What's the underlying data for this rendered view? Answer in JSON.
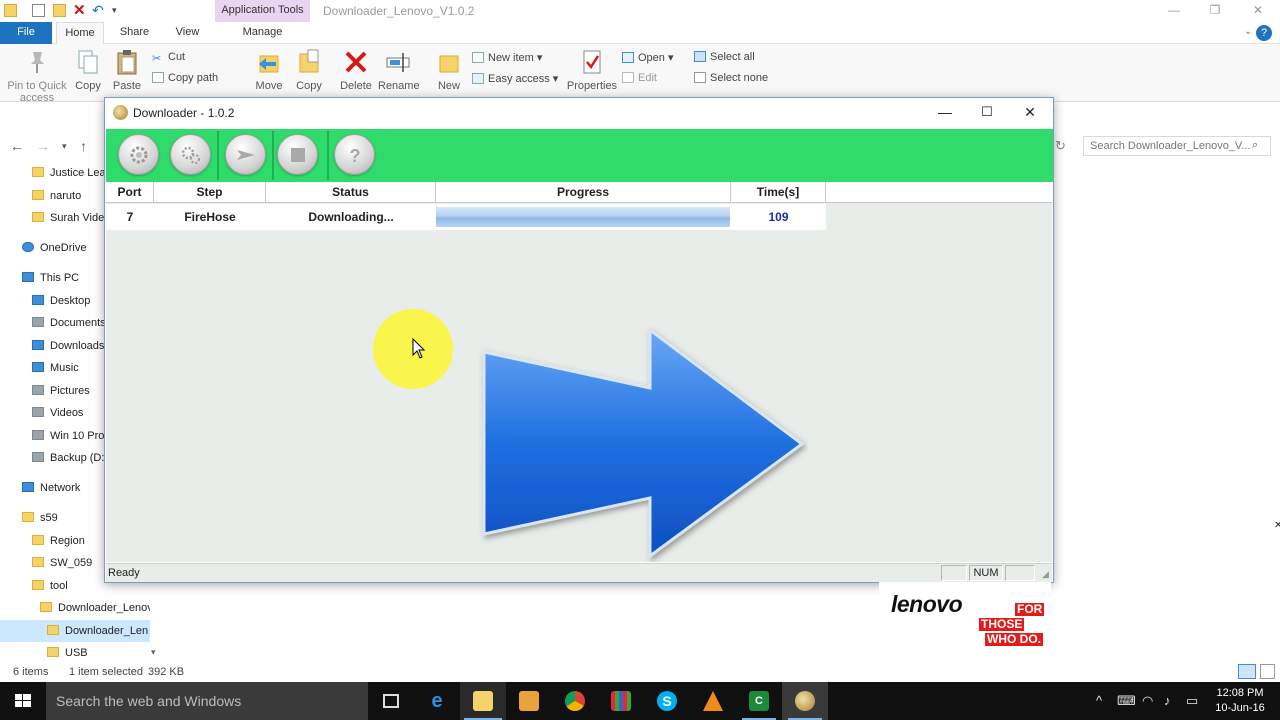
{
  "explorer": {
    "title": "Downloader_Lenovo_V1.0.2",
    "app_tools": "Application Tools",
    "tabs": {
      "file": "File",
      "home": "Home",
      "share": "Share",
      "view": "View",
      "manage": "Manage"
    },
    "ribbon": {
      "pin": "Pin to Quick access",
      "copy": "Copy",
      "paste": "Paste",
      "cut": "Cut",
      "copy_path": "Copy path",
      "move": "Move",
      "copy_to": "Copy",
      "delete": "Delete",
      "rename": "Rename",
      "new": "New",
      "new_item": "New item",
      "easy_access": "Easy access",
      "properties": "Properties",
      "open": "Open",
      "edit": "Edit",
      "select_all": "Select all",
      "select_none": "Select none"
    },
    "search_placeholder": "Search Downloader_Lenovo_V...",
    "nav": [
      {
        "label": "Justice Leag",
        "kind": "folder"
      },
      {
        "label": "naruto",
        "kind": "folder"
      },
      {
        "label": "Surah Video",
        "kind": "folder"
      },
      {
        "label": "OneDrive",
        "kind": "cloud"
      },
      {
        "label": "This PC",
        "kind": "pc"
      },
      {
        "label": "Desktop",
        "kind": "blue"
      },
      {
        "label": "Documents",
        "kind": "gray"
      },
      {
        "label": "Downloads",
        "kind": "blue"
      },
      {
        "label": "Music",
        "kind": "blue"
      },
      {
        "label": "Pictures",
        "kind": "gray"
      },
      {
        "label": "Videos",
        "kind": "gray"
      },
      {
        "label": "Win 10 Pro",
        "kind": "drive"
      },
      {
        "label": "Backup (D:",
        "kind": "drive"
      },
      {
        "label": "Network",
        "kind": "network"
      },
      {
        "label": "s59",
        "kind": "folder"
      },
      {
        "label": "Region",
        "kind": "folder"
      },
      {
        "label": "SW_059",
        "kind": "folder"
      },
      {
        "label": "tool",
        "kind": "folder"
      },
      {
        "label": "Downloader_Lenov",
        "kind": "folder"
      },
      {
        "label": "Downloader_Len",
        "kind": "folder"
      },
      {
        "label": "USB",
        "kind": "folder"
      }
    ],
    "status": {
      "items": "6 items",
      "selected": "1 item selected",
      "size": "392 KB"
    }
  },
  "downloader": {
    "title": "Downloader - 1.0.2",
    "columns": [
      "Port",
      "Step",
      "Status",
      "Progress",
      "Time(s]"
    ],
    "row": {
      "port": "7",
      "step": "FireHose",
      "status": "Downloading...",
      "progress": 1.0,
      "time": "109"
    },
    "status_text": "Ready",
    "num_indicator": "NUM",
    "toolbar": [
      "settings-icon",
      "options-icon",
      "start-icon",
      "stop-icon",
      "help-icon"
    ],
    "toolbar_color": "#2edb6b",
    "logo": {
      "brand": "lenovo",
      "tag1": "FOR",
      "tag2": "THOSE",
      "tag3": "WHO DO."
    }
  },
  "taskbar": {
    "search_placeholder": "Search the web and Windows",
    "time": "12:08 PM",
    "date": "10-Jun-16"
  }
}
